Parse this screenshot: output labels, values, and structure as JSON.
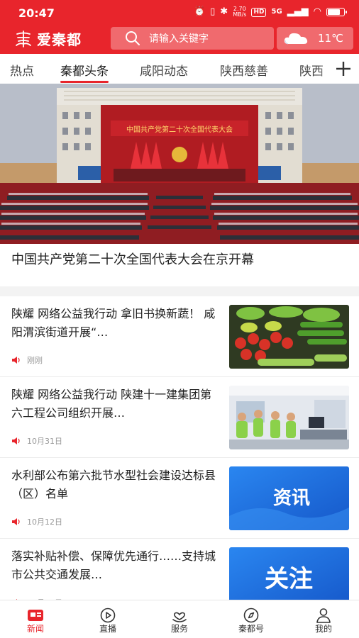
{
  "status_bar": {
    "time": "20:47",
    "speed_value": "2.70",
    "speed_unit": "MB/s",
    "hd": "HD",
    "network": "5G"
  },
  "header": {
    "logo_text": "爱秦都",
    "search_placeholder": "请输入关键字",
    "weather_temp": "11℃",
    "icons": [
      "search-icon",
      "cloud-icon"
    ]
  },
  "tabs": [
    {
      "label": "热点",
      "active": false
    },
    {
      "label": "秦都头条",
      "active": true
    },
    {
      "label": "咸阳动态",
      "active": false
    },
    {
      "label": "陕西慈善",
      "active": false
    },
    {
      "label": "陕西",
      "active": false
    }
  ],
  "hero": {
    "banner_text": "中国共产党第二十次全国代表大会",
    "title": "中国共产党第二十次全国代表大会在京开幕"
  },
  "news": [
    {
      "title": "陕耀 网络公益我行动 拿旧书换新蔬！ 咸阳渭滨街道开展“…",
      "time": "刚刚",
      "thumb": "vegetables-photo"
    },
    {
      "title": "陕耀 网络公益我行动 陕建十一建集团第六工程公司组织开展…",
      "time": "10月31日",
      "thumb": "volunteers-photo"
    },
    {
      "title": "水利部公布第六批节水型社会建设达标县（区）名单",
      "time": "10月12日",
      "thumb_label": "资讯"
    },
    {
      "title": "落实补贴补偿、保障优先通行……支持城市公共交通发展…",
      "time": "10月12日",
      "thumb_label": "关注"
    }
  ],
  "bottom_nav": [
    {
      "label": "新闻",
      "icon": "news-icon",
      "active": true
    },
    {
      "label": "直播",
      "icon": "play-icon",
      "active": false
    },
    {
      "label": "服务",
      "icon": "heart-hand-icon",
      "active": false
    },
    {
      "label": "秦都号",
      "icon": "compass-icon",
      "active": false
    },
    {
      "label": "我的",
      "icon": "user-icon",
      "active": false
    }
  ],
  "colors": {
    "brand_red": "#e8252c",
    "card_blue": "#1d6fe0"
  }
}
